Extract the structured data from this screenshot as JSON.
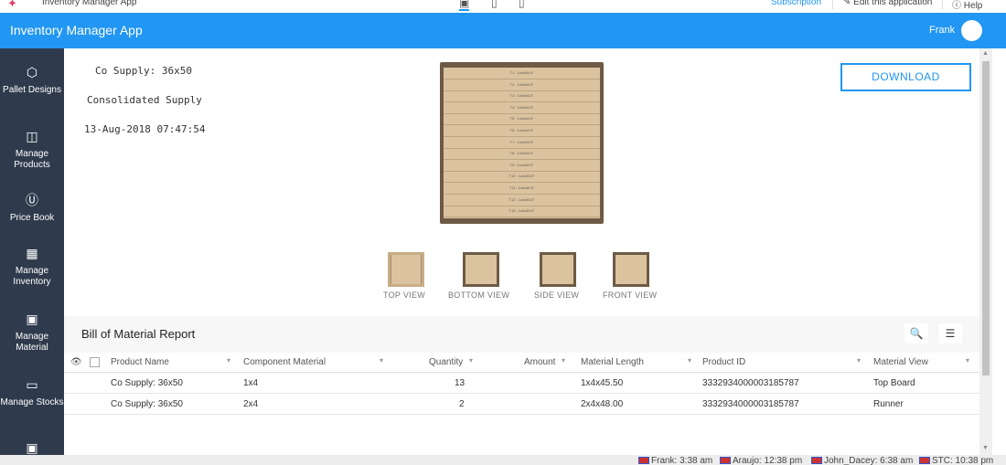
{
  "topbar": {
    "app_title": "Inventory Manager App",
    "subscription": "Subscription",
    "edit_app": "Edit this application",
    "help": "Help",
    "logo_icon": "app-logo-icon",
    "device_icons": [
      "desktop-icon",
      "tablet-icon",
      "mobile-icon"
    ]
  },
  "header": {
    "title": "Inventory Manager App",
    "user": "Frank",
    "accent_color": "#2196f3"
  },
  "sidebar": {
    "items": [
      {
        "label": "Pallet Designs",
        "icon": "cube-icon"
      },
      {
        "label": "Manage Products",
        "icon": "board-icon"
      },
      {
        "label": "Price Book",
        "icon": "dollar-icon"
      },
      {
        "label": "Manage Inventory",
        "icon": "layers-icon"
      },
      {
        "label": "Manage Material",
        "icon": "monitor-icon"
      },
      {
        "label": "Manage Stocks",
        "icon": "battery-icon"
      },
      {
        "label": "",
        "icon": "monitor-icon"
      }
    ]
  },
  "info": {
    "name": "Co Supply: 36x50",
    "company": "Consolidated Supply",
    "datetime": "13-Aug-2018 07:47:54"
  },
  "pallet": {
    "boards": [
      "T1 : 1x4x45.5\"",
      "T2 : 1x4x45.5\"",
      "T3 : 1x4x45.5\"",
      "T4 : 1x4x45.5\"",
      "T5 : 1x4x45.5\"",
      "T6 : 1x4x45.5\"",
      "T7 : 1x4x45.5\"",
      "T8 : 1x4x45.5\"",
      "T9 : 1x4x45.5\"",
      "T10 : 1x4x45.5\"",
      "T11 : 1x4x45.5\"",
      "T12 : 1x4x45.5\"",
      "T13 : 1x4x45.5\""
    ]
  },
  "download_label": "DOWNLOAD",
  "views": [
    "TOP VIEW",
    "BOTTOM VIEW",
    "SIDE VIEW",
    "FRONT VIEW"
  ],
  "bom": {
    "title": "Bill of Material Report",
    "columns": [
      "Product Name",
      "Component Material",
      "Quantity",
      "Amount",
      "Material Length",
      "Product ID",
      "Material View"
    ],
    "rows": [
      {
        "product": "Co Supply: 36x50",
        "component": "1x4",
        "quantity": "13",
        "amount": "",
        "length": "1x4x45.50",
        "id": "3332934000003185787",
        "view": "Top Board"
      },
      {
        "product": "Co Supply: 36x50",
        "component": "2x4",
        "quantity": "2",
        "amount": "",
        "length": "2x4x48.00",
        "id": "3332934000003185787",
        "view": "Runner"
      }
    ]
  },
  "statusbar": [
    "Frank: 3:38 am",
    "Araujo: 12:38 pm",
    "John_Dacey: 6:38 am",
    "STC: 10:38 pm"
  ]
}
